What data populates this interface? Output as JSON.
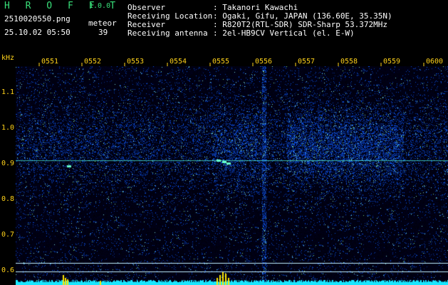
{
  "header": {
    "app_title": "H R O F F T",
    "version": "1.0.0",
    "filename": "2510020550.png",
    "datetime": "25.10.02 05:50",
    "meteor_label": "meteor",
    "meteor_count": "39"
  },
  "station": {
    "rows": [
      {
        "label": "Observer",
        "sep": ":",
        "value": "Takanori Kawachi"
      },
      {
        "label": "Receiving Location",
        "sep": ":",
        "value": "Ogaki, Gifu, JAPAN (136.60E, 35.35N)"
      },
      {
        "label": "Receiver",
        "sep": ":",
        "value": "R820T2(RTL-SDR) SDR-Sharp 53.372MHz"
      },
      {
        "label": "Receiving antenna",
        "sep": ":",
        "value": "2el-HB9CV Vertical (el. E-W)"
      }
    ]
  },
  "axes": {
    "y_unit": "kHz",
    "y_ticks": [
      "1.1",
      "1.0",
      "0.9",
      "0.8",
      "0.7",
      "0.6"
    ],
    "x_ticks": [
      "0551",
      "0552",
      "0553",
      "0554",
      "0555",
      "0556",
      "0557",
      "0558",
      "0559",
      "0600"
    ]
  },
  "colors": {
    "background": "#000000",
    "title_green": "#39e07a",
    "axis_yellow": "#ffd21a",
    "noise_blue": "#1a3cff",
    "signal_cyan": "#33ffff"
  }
}
